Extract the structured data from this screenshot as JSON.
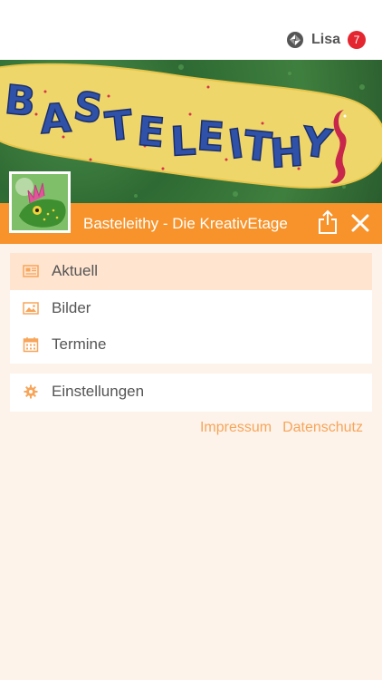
{
  "user": {
    "name": "Lisa",
    "notification_count": "7"
  },
  "banner": {
    "sign_text": "BASTELEITHY"
  },
  "group": {
    "title": "Basteleithy - Die KreativEtage"
  },
  "menu": [
    {
      "label": "Aktuell",
      "icon": "newspaper-icon",
      "active": true
    },
    {
      "label": "Bilder",
      "icon": "image-icon",
      "active": false
    },
    {
      "label": "Termine",
      "icon": "calendar-icon",
      "active": false
    }
  ],
  "settings": {
    "label": "Einstellungen",
    "icon": "gear-icon"
  },
  "footer": {
    "impressum": "Impressum",
    "datenschutz": "Datenschutz"
  },
  "colors": {
    "accent": "#f7932a",
    "badge": "#e3262f",
    "background": "#fdf3ea",
    "active_row": "#ffe5d0",
    "link": "#f7a55a"
  }
}
